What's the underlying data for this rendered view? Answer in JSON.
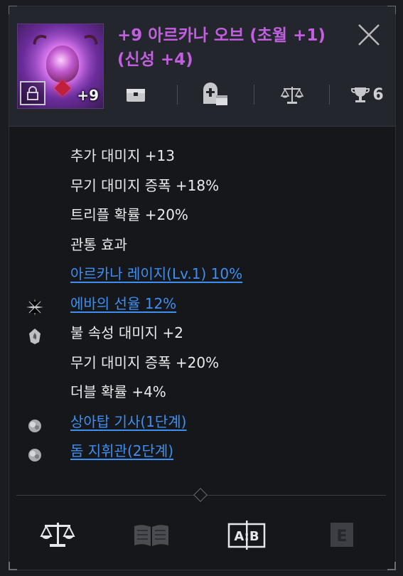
{
  "item": {
    "enhance_level": "+9",
    "title": "+9 아르카나 오브 (초월 +1) (신성 +4)",
    "score": "6"
  },
  "stats": [
    {
      "text": "추가 대미지 +13",
      "link": false,
      "icon": null
    },
    {
      "text": "무기 대미지 증폭 +18%",
      "link": false,
      "icon": null
    },
    {
      "text": "트리플 확률 +20%",
      "link": false,
      "icon": null
    },
    {
      "text": "관통 효과",
      "link": false,
      "icon": null
    },
    {
      "text": "아르카나 레이지(Lv.1) 10%",
      "link": true,
      "icon": null
    },
    {
      "text": "에바의 선율 12%",
      "link": true,
      "icon": "sparkle-icon"
    },
    {
      "text": "불 속성 대미지 +2",
      "link": false,
      "icon": "flame-rune-icon"
    },
    {
      "text": "무기 대미지 증폭 +20%",
      "link": false,
      "icon": null
    },
    {
      "text": "더블 확률 +4%",
      "link": false,
      "icon": null
    },
    {
      "text": "상아탑 기사(1단계)",
      "link": true,
      "icon": "set-orb-icon"
    },
    {
      "text": "돔 지휘관(2단계)",
      "link": true,
      "icon": "set-orb-icon"
    }
  ],
  "footer": {
    "compare_label": "A:B",
    "key_label": "E"
  },
  "colors": {
    "title": "#c15fe0",
    "link": "#3e8fef",
    "text": "#ebebed",
    "panel": "#15171b",
    "header": "#23262c"
  }
}
